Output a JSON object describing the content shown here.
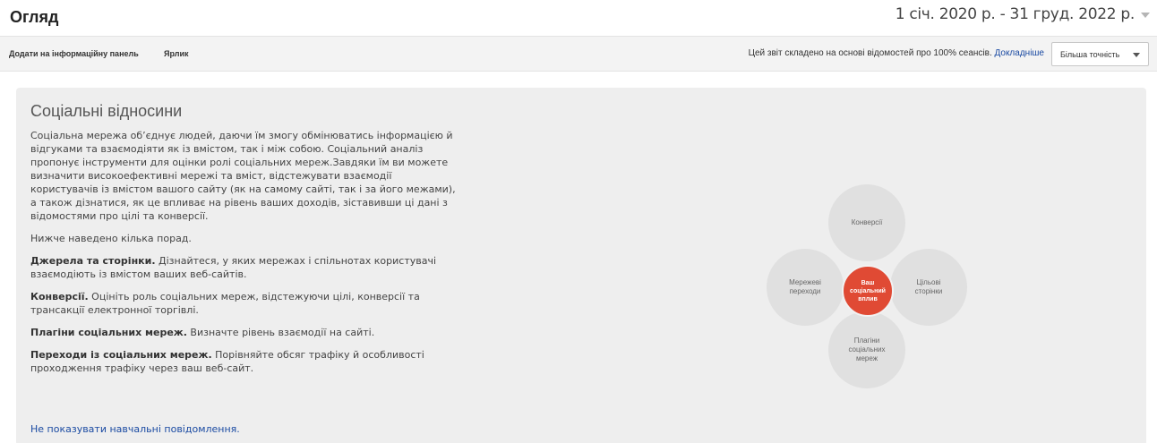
{
  "header": {
    "title": "Огляд",
    "date_range": "1 січ. 2020 р. - 31 груд. 2022 р."
  },
  "toolbar": {
    "add_to_dashboard": "Додати на інформаційну панель",
    "shortcut": "Ярлик",
    "report_note": "Цей звіт складено на основі відомостей про 100% сеансів.",
    "learn_more": "Докладніше",
    "precision": "Більша точність"
  },
  "panel": {
    "title": "Соціальні відносини",
    "intro": "Соціальна мережа об’єднує людей, даючи їм змогу обмінюватись інформацією й відгуками та взаємодіяти як із вмістом, так і між собою. Соціальний аналіз пропонує інструменти для оцінки ролі соціальних мереж.Завдяки їм ви можете визначити високоефективні мережі та вміст, відстежувати взаємодії користувачів із вмістом вашого сайту (як на самому сайті, так і за його межами), а також дізнатися, як це впливає на рівень ваших доходів, зіставивши ці дані з відомостями про цілі та конверсії.",
    "tips_intro": "Нижче наведено кілька порад.",
    "tips": [
      {
        "title": "Джерела та сторінки.",
        "text": " Дізнайтеся, у яких мережах і спільнотах користувачі взаємодіють із вмістом ваших веб-сайтів."
      },
      {
        "title": "Конверсії.",
        "text": " Оцініть роль соціальних мереж, відстежуючи цілі, конверсії та трансакції електронної торгівлі."
      },
      {
        "title": "Плагіни соціальних мереж.",
        "text": " Визначте рівень взаємодії на сайті."
      },
      {
        "title": "Переходи із соціальних мереж.",
        "text": " Порівняйте обсяг трафіку й особливості проходження трафіку через ваш веб-сайт."
      }
    ],
    "hide_link": "Не показувати навчальні повідомлення."
  },
  "diagram": {
    "top": "Конверсії",
    "left": "Мережеві переходи",
    "right": "Цільові сторінки",
    "bottom": "Плагіни соціальних мереж",
    "center": "Ваш соціальний вплив",
    "center_color": "#e04a34"
  }
}
